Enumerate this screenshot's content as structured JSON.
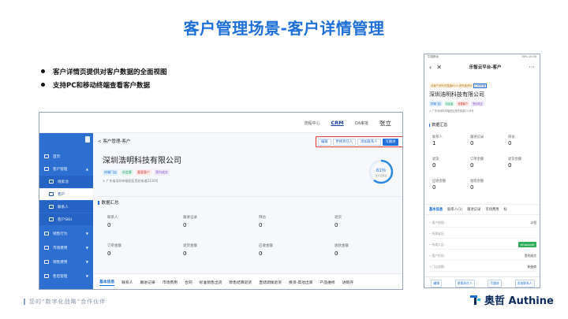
{
  "slide": {
    "title": "客户管理场景-客户详情管理",
    "bullets": [
      "客户详情页提供对客户数据的全面视图",
      "支持PC和移动终端查看客户数据"
    ],
    "tagline": "您的“数字化战略”合作伙伴",
    "logo_text": "奥哲 Authine"
  },
  "desktop": {
    "top_nav": {
      "item1": "流程中心",
      "item2": "CRM",
      "item3": "OA审批",
      "user": "张立"
    },
    "sidebar": [
      {
        "label": "首页"
      },
      {
        "label": "客户管理"
      },
      {
        "label": "线索池"
      },
      {
        "label": "客户"
      },
      {
        "label": "联系人"
      },
      {
        "label": "客户SKU"
      },
      {
        "label": "销售行为"
      },
      {
        "label": "市场费用"
      },
      {
        "label": "销售费用"
      },
      {
        "label": "售后管理"
      }
    ],
    "breadcrumb": "< 客户管理-客户",
    "actions": [
      "编辑",
      "更换责任人",
      "添加联系人",
      "写跟进"
    ],
    "company": "深圳浩明科技有限公司",
    "tags": [
      "终端门店",
      "机会客",
      "重要客户",
      "签约成交"
    ],
    "address": "广东省深圳市福田区莲花街道2116号",
    "ring": {
      "percent": "61%",
      "label": "客户完整度"
    },
    "section_title": "数据汇总",
    "stats": [
      {
        "label": "联系人",
        "value": "0"
      },
      {
        "label": "跟进记录",
        "value": "0"
      },
      {
        "label": "拜访",
        "value": "0"
      },
      {
        "label": "退货",
        "value": "0"
      },
      {
        "label": "订单金额",
        "value": "0"
      },
      {
        "label": "退货金额",
        "value": "0"
      },
      {
        "label": "应收金额",
        "value": "0"
      },
      {
        "label": "收款金额",
        "value": "0"
      }
    ],
    "tabs": [
      "基本信息",
      "联系人",
      "跟进记录",
      "市场费用",
      "合同",
      "标准销售出货",
      "赊售结算退货",
      "直储调拨退货",
      "换货-其他出库",
      "产品维修",
      "进销存"
    ]
  },
  "mobile": {
    "status_left": "中国移动",
    "status_right": "76% 15:30",
    "nav_title": "乐智云平台-客户",
    "hint": "该客户资料完整度61%,请完善资料",
    "hint_link": "立即完善",
    "company": "深圳浩明科技有限公司",
    "tags": [
      "终端门店",
      "机会客",
      "重要客户",
      "签约成交"
    ],
    "address": "广东省深圳市福田区莲花街道2116号",
    "section_title": "数据汇总",
    "stats": [
      {
        "label": "联系人",
        "value": "1"
      },
      {
        "label": "跟进记录",
        "value": "0"
      },
      {
        "label": "拜访",
        "value": "0"
      },
      {
        "label": "退货",
        "value": "0"
      },
      {
        "label": "订单金额",
        "value": "0"
      },
      {
        "label": "退货金额",
        "value": "0"
      },
      {
        "label": "应收金额",
        "value": "0"
      },
      {
        "label": "收款金额",
        "value": "0"
      }
    ],
    "tabs": [
      "基本信息",
      "联系人(1)",
      "跟进记录",
      "市场费用",
      "标"
    ],
    "rows": [
      {
        "label": "• 客户经理:",
        "value": "以恒"
      },
      {
        "label": "• 所属省区:",
        "value": ""
      },
      {
        "label": "• 所属大区:",
        "value": "eConsole"
      },
      {
        "label": "• 客户阶段:",
        "value": "签约成交"
      },
      {
        "label": "• 门店规模:",
        "value": "制造商"
      }
    ],
    "bottom": [
      "编辑",
      "更换责任人",
      "写跟进",
      "添加联系人"
    ]
  },
  "colors": {
    "accent": "#1e6fd9",
    "sidebar": "#2c6fd1",
    "highlight": "#e53935"
  }
}
